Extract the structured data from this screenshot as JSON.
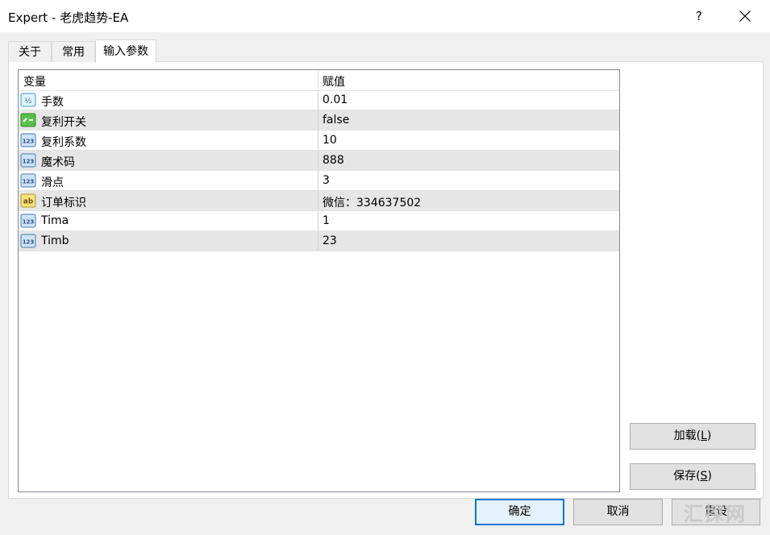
{
  "window": {
    "title": "Expert - 老虎趋势-EA",
    "help_label": "?"
  },
  "tabs": [
    {
      "label": "关于",
      "active": false
    },
    {
      "label": "常用",
      "active": false
    },
    {
      "label": "输入参数",
      "active": true
    }
  ],
  "grid": {
    "columns": [
      "变量",
      "赋值"
    ],
    "rows": [
      {
        "icon": "fraction-icon",
        "name": "手数",
        "value": "0.01"
      },
      {
        "icon": "bool-toggle-icon",
        "name": "复利开关",
        "value": "false"
      },
      {
        "icon": "numeric-123-icon",
        "name": "复利系数",
        "value": "10"
      },
      {
        "icon": "numeric-123-icon",
        "name": "魔术码",
        "value": "888"
      },
      {
        "icon": "numeric-123-icon",
        "name": "滑点",
        "value": "3"
      },
      {
        "icon": "string-ab-icon",
        "name": "订单标识",
        "value": "微信：334637502"
      },
      {
        "icon": "numeric-123-icon",
        "name": "Tima",
        "value": "1"
      },
      {
        "icon": "numeric-123-icon",
        "name": "Timb",
        "value": "23"
      }
    ]
  },
  "buttons": {
    "load": {
      "label": "加载(",
      "mnemonic": "L",
      "suffix": ")"
    },
    "save": {
      "label": "保存(",
      "mnemonic": "S",
      "suffix": ")"
    },
    "ok": "确定",
    "cancel": "取消",
    "reset": "重设"
  },
  "watermark": "汇探网"
}
